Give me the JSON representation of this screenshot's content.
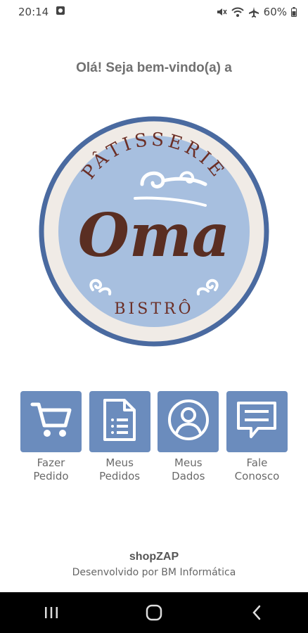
{
  "status_bar": {
    "time": "20:14",
    "battery": "60%",
    "icons": [
      "notification-icon",
      "mute-icon",
      "wifi-icon",
      "airplane-icon",
      "battery-icon"
    ]
  },
  "welcome_text": "Olá! Seja bem-vindo(a) a",
  "logo": {
    "top_text": "PÂTISSERIE",
    "brand": "Oma",
    "bottom_text": "BISTRÔ"
  },
  "menu": {
    "items": [
      {
        "label": "Fazer\nPedido",
        "icon": "cart-icon"
      },
      {
        "label": "Meus\nPedidos",
        "icon": "document-list-icon"
      },
      {
        "label": "Meus\nDados",
        "icon": "user-icon"
      },
      {
        "label": "Fale\nConosco",
        "icon": "chat-icon"
      }
    ]
  },
  "footer": {
    "brand": "shopZAP",
    "developer": "Desenvolvido por BM Informática"
  },
  "navbar": {
    "icons": [
      "recent-apps-icon",
      "home-icon",
      "back-icon"
    ]
  },
  "colors": {
    "tile": "#6b8cbd",
    "logo_ring": "#4a6aa0",
    "logo_fill": "#a7bfdf",
    "brand_brown": "#5a2e22"
  }
}
